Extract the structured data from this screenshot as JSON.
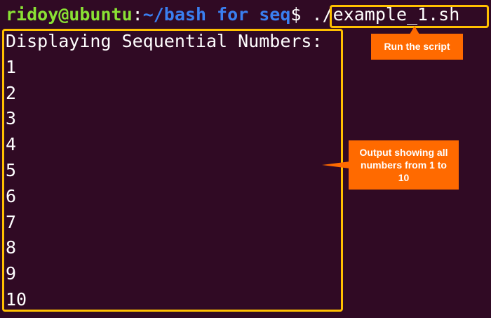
{
  "prompt": {
    "user_host": "ridoy@ubuntu",
    "colon": ":",
    "path": "~/bash for seq",
    "dollar": "$",
    "command": "./example_1.sh"
  },
  "output_lines": [
    "Displaying Sequential Numbers:",
    "1",
    "2",
    "3",
    "4",
    "5",
    "6",
    "7",
    "8",
    "9",
    "10"
  ],
  "annotations": {
    "run_script": "Run the script",
    "output_note": "Output showing all numbers from 1 to 10"
  },
  "colors": {
    "background": "#300a24",
    "user_host": "#8ae234",
    "path": "#3a7ff0",
    "text": "#ffffff",
    "highlight_border": "#ffc000",
    "callout_fill": "#ff6a00"
  }
}
